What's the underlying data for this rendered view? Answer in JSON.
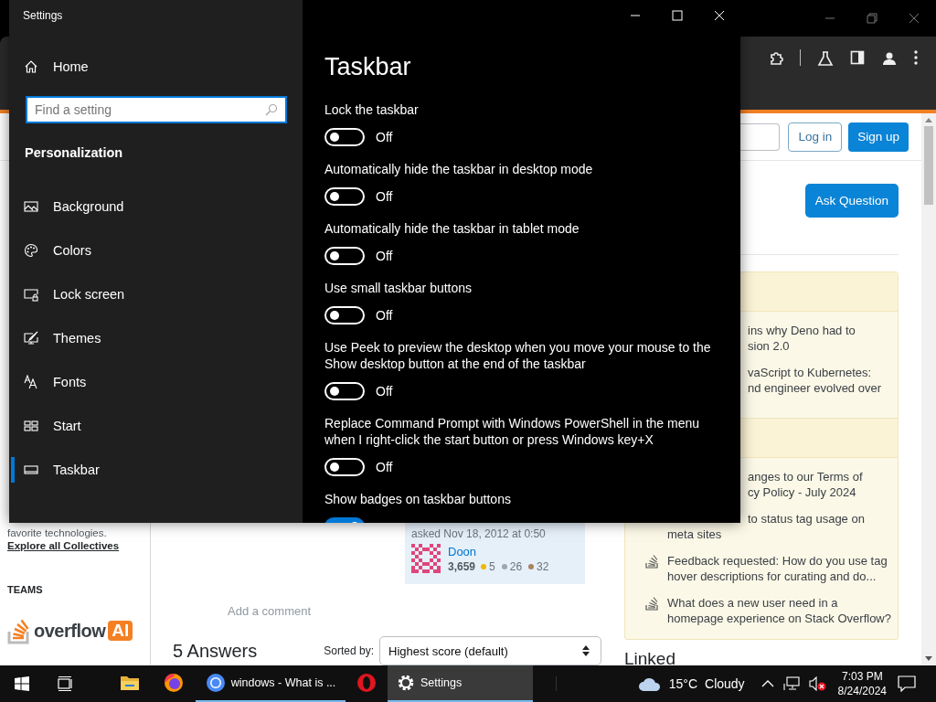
{
  "browser": {
    "header": {
      "login": "Log in",
      "signup": "Sign up"
    },
    "left_sidebar": {
      "collectives_text": "favorite technologies.",
      "collectives_link": "Explore all Collectives",
      "teams_heading": "TEAMS",
      "logo_word": "overflow",
      "logo_badge": "AI"
    },
    "question_owner": {
      "asked": "asked Nov 18, 2012 at 0:50",
      "user": "Doon",
      "reputation": "3,659",
      "badges": [
        {
          "count": "5",
          "color": "#f1b600"
        },
        {
          "count": "26",
          "color": "#9fa6ad"
        },
        {
          "count": "32",
          "color": "#ab825f"
        }
      ]
    },
    "add_comment": "Add a comment",
    "answers_heading": "5 Answers",
    "sort_label": "Sorted by:",
    "sort_value": "Highest score (default)",
    "ask_button": "Ask Question",
    "widget_sections": [
      {
        "items": [
          {
            "kind": "covered",
            "lines": [
              {
                "text": "ins why Deno had to",
                "covered": true
              },
              {
                "text": "sion 2.0",
                "covered": true
              }
            ]
          },
          {
            "kind": "covered",
            "lines": [
              {
                "text": "vaScript to Kubernetes:",
                "covered": true
              },
              {
                "text": "nd engineer evolved over",
                "covered": true
              }
            ]
          }
        ]
      },
      {
        "items": [
          {
            "kind": "covered",
            "lines": [
              {
                "text": "anges to our Terms of",
                "covered": true
              },
              {
                "text": "cy Policy - July 2024",
                "covered": true
              }
            ]
          },
          {
            "kind": "covered",
            "lines": [
              {
                "text": "to status tag usage on",
                "covered": true
              },
              {
                "text": "meta sites",
                "covered": false
              }
            ]
          },
          {
            "kind": "full",
            "lines": [
              {
                "text": "Feedback requested: How do you use tag",
                "covered": false
              },
              {
                "text": "hover descriptions for curating and do...",
                "covered": false
              }
            ]
          },
          {
            "kind": "full",
            "lines": [
              {
                "text": "What does a new user need in a",
                "covered": false
              },
              {
                "text": "homepage experience on Stack Overflow?",
                "covered": false
              }
            ]
          }
        ]
      }
    ],
    "linked_heading": "Linked"
  },
  "settings": {
    "title": "Settings",
    "home": "Home",
    "search": {
      "placeholder": "Find a setting"
    },
    "section": "Personalization",
    "nav": [
      {
        "kind": "background",
        "label": "Background",
        "selected": false
      },
      {
        "kind": "colors",
        "label": "Colors",
        "selected": false
      },
      {
        "kind": "lockscreen",
        "label": "Lock screen",
        "selected": false
      },
      {
        "kind": "themes",
        "label": "Themes",
        "selected": false
      },
      {
        "kind": "fonts",
        "label": "Fonts",
        "selected": false
      },
      {
        "kind": "start",
        "label": "Start",
        "selected": false
      },
      {
        "kind": "taskbar",
        "label": "Taskbar",
        "selected": true
      }
    ],
    "page_title": "Taskbar",
    "items": [
      {
        "label": "Lock the taskbar",
        "on": false,
        "state_text": "Off"
      },
      {
        "label": "Automatically hide the taskbar in desktop mode",
        "on": false,
        "state_text": "Off"
      },
      {
        "label": "Automatically hide the taskbar in tablet mode",
        "on": false,
        "state_text": "Off"
      },
      {
        "label": "Use small taskbar buttons",
        "on": false,
        "state_text": "Off"
      },
      {
        "label": "Use Peek to preview the desktop when you move your mouse to the Show desktop button at the end of the taskbar",
        "on": false,
        "state_text": "Off"
      },
      {
        "label": "Replace Command Prompt with Windows PowerShell in the menu when I right-click the start button or press Windows key+X",
        "on": false,
        "state_text": "Off"
      },
      {
        "label": "Show badges on taskbar buttons",
        "on": true
      }
    ]
  },
  "taskbar": {
    "apps": [
      {
        "kind": "files",
        "open": false,
        "selected": false
      },
      {
        "kind": "firefox",
        "open": false,
        "selected": false
      },
      {
        "kind": "chrome",
        "label": "windows - What is ...",
        "open": true,
        "selected": false
      },
      {
        "kind": "opera",
        "open": false,
        "selected": false
      },
      {
        "kind": "settings",
        "label": "Settings",
        "open": true,
        "selected": true
      }
    ],
    "weather": {
      "temp": "15°C",
      "condition": "Cloudy"
    },
    "time": "7:03 PM",
    "date": "8/24/2024"
  }
}
